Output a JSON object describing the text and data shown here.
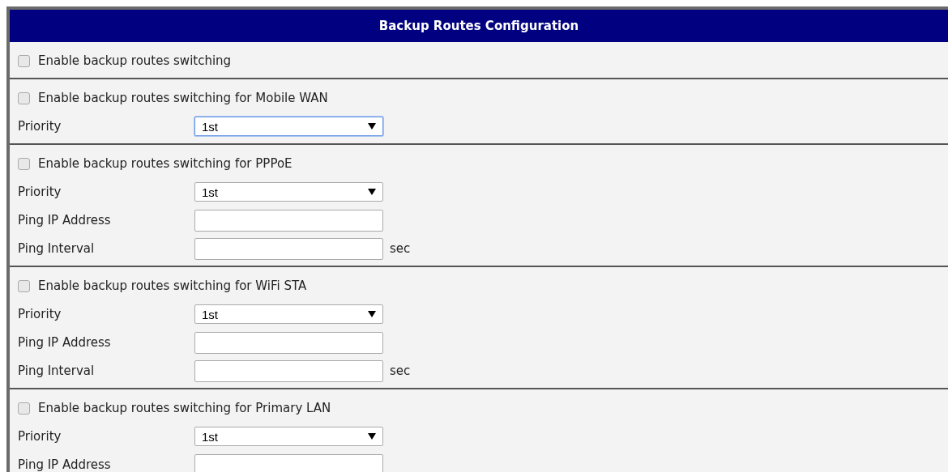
{
  "title": "Backup Routes Configuration",
  "sections": [
    {
      "checkbox": {
        "label": "Enable backup routes switching",
        "checked": false
      }
    },
    {
      "checkbox": {
        "label": "Enable backup routes switching for Mobile WAN",
        "checked": false
      },
      "fields": [
        {
          "kind": "select",
          "label": "Priority",
          "value": "1st",
          "focused": true
        }
      ]
    },
    {
      "checkbox": {
        "label": "Enable backup routes switching for PPPoE",
        "checked": false
      },
      "fields": [
        {
          "kind": "select",
          "label": "Priority",
          "value": "1st",
          "focused": false
        },
        {
          "kind": "input",
          "label": "Ping IP Address",
          "focused": false
        },
        {
          "kind": "input",
          "label": "Ping Interval",
          "unit": "sec",
          "focused": false
        }
      ]
    },
    {
      "checkbox": {
        "label": "Enable backup routes switching for WiFi STA",
        "checked": false
      },
      "fields": [
        {
          "kind": "select",
          "label": "Priority",
          "value": "1st",
          "focused": false
        },
        {
          "kind": "input",
          "label": "Ping IP Address",
          "focused": false
        },
        {
          "kind": "input",
          "label": "Ping Interval",
          "unit": "sec",
          "focused": false
        }
      ]
    },
    {
      "checkbox": {
        "label": "Enable backup routes switching for Primary LAN",
        "checked": false
      },
      "fields": [
        {
          "kind": "select",
          "label": "Priority",
          "value": "1st",
          "focused": false
        },
        {
          "kind": "input",
          "label": "Ping IP Address",
          "focused": false
        }
      ]
    }
  ]
}
